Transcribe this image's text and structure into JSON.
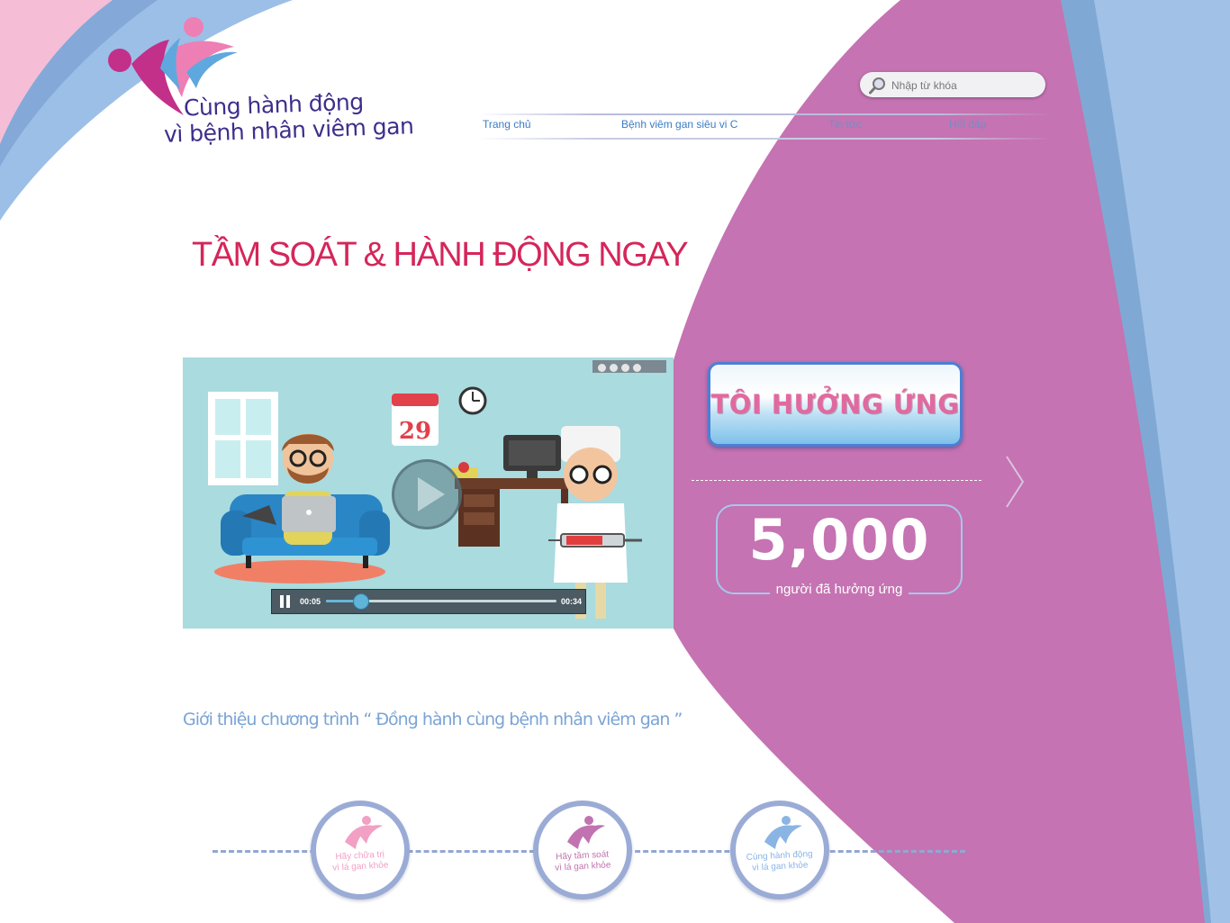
{
  "logo": {
    "line1": "Cùng hành động",
    "line2": "vì bệnh nhân viêm gan"
  },
  "search": {
    "placeholder": "Nhập từ khóa",
    "icon": "magnifier-icon"
  },
  "nav": [
    {
      "label": "Trang chủ"
    },
    {
      "label": "Bệnh viêm gan siêu vi C"
    },
    {
      "label": "Tin tức"
    },
    {
      "label": "Hỏi đáp"
    }
  ],
  "headline": "TẦM SOÁT & HÀNH ĐỘNG NGAY",
  "video": {
    "calendar_day": "29",
    "current_time": "00:05",
    "duration": "00:34",
    "progress": 0.15
  },
  "cta": {
    "label": "TÔI HƯỞNG ỨNG"
  },
  "counter": {
    "value": "5,000",
    "label": "người đã hưởng ứng"
  },
  "intro": "Giới thiệu chương trình “ Đồng hành cùng bệnh nhân viêm gan ”",
  "badges": [
    {
      "line1": "Hãy chữa trị",
      "line2": "vì lá gan khỏe",
      "color": "#f2a0c4"
    },
    {
      "line1": "Hãy tầm soát",
      "line2": "vì lá gan khỏe",
      "color": "#c173b1"
    },
    {
      "line1": "Cùng hành động",
      "line2": "vì lá gan khỏe",
      "color": "#8ab4e4"
    }
  ],
  "colors": {
    "pink_panel": "#c573b2",
    "blue_stripe": "#9bbde5",
    "headline": "#d4265a",
    "nav_link": "#3b7cc5"
  }
}
